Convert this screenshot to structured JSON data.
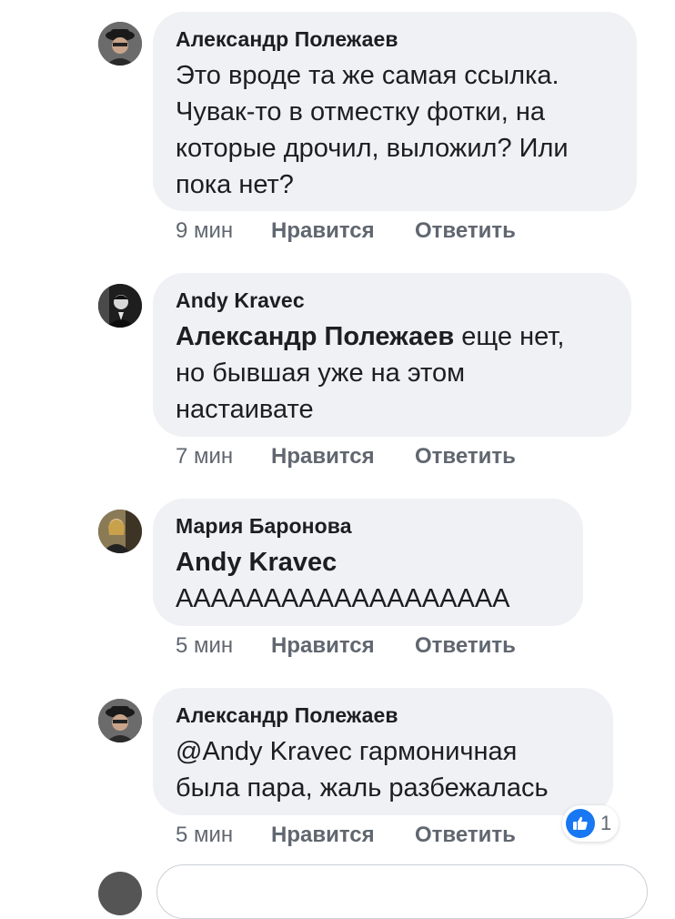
{
  "comments": [
    {
      "author": "Александр Полежаев",
      "mention": "",
      "text": "Это вроде та же самая ссылка.\nЧувак-то в отместку фотки, на\nкоторые дрочил, выложил? Или\nпока нет?",
      "time": "9 мин",
      "like_label": "Нравится",
      "reply_label": "Ответить"
    },
    {
      "author": "Andy Kravec",
      "mention": "Александр Полежаев",
      "text": " еще нет,\nно бывшая уже на этом\nнастаивате",
      "time": "7 мин",
      "like_label": "Нравится",
      "reply_label": "Ответить"
    },
    {
      "author": "Мария Баронова",
      "mention": "Andy Kravec",
      "text": "\nААААААААААААААААААА",
      "time": "5 мин",
      "like_label": "Нравится",
      "reply_label": "Ответить"
    },
    {
      "author": "Александр Полежаев",
      "mention": "",
      "text": "@Andy Kravec гармоничная\nбыла пара, жаль разбежалась",
      "time": "5 мин",
      "like_label": "Нравится",
      "reply_label": "Ответить",
      "reaction_count": "1"
    }
  ],
  "icons": {
    "reaction": "thumbs-up-icon"
  },
  "colors": {
    "bubble": "#f0f1f4",
    "meta_text": "#606770",
    "like_blue": "#1877f2"
  }
}
